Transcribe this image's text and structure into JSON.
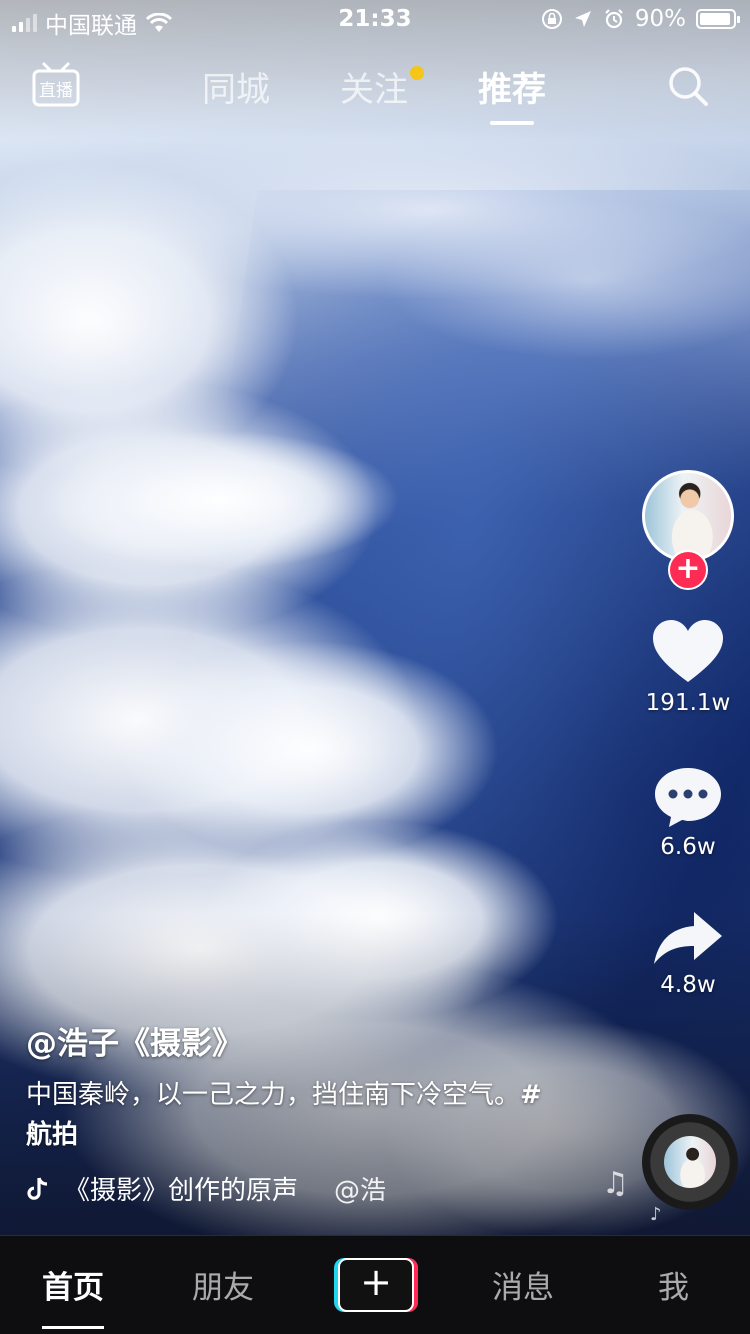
{
  "status_bar": {
    "carrier": "中国联通",
    "time": "21:33",
    "battery_percent": "90%"
  },
  "top_nav": {
    "live_label": "直播",
    "tabs": [
      {
        "label": "同城",
        "active": false
      },
      {
        "label": "关注",
        "active": false,
        "has_dot": true
      },
      {
        "label": "推荐",
        "active": true
      }
    ],
    "dot_color": "#f5c518"
  },
  "actions": {
    "likes": "191.1w",
    "comments": "6.6w",
    "shares": "4.8w",
    "follow_plus": "+",
    "accent_color": "#fe2c55"
  },
  "video_info": {
    "author": "@浩子《摄影》",
    "description": "中国秦岭，以一己之力，挡住南下冷空气。",
    "hashtag": "#航拍",
    "music": "《摄影》创作的原声",
    "music_scroll_extra": "@浩"
  },
  "tab_bar": {
    "items": [
      "首页",
      "朋友",
      "消息",
      "我"
    ],
    "active_index": 0,
    "plus_label": "+"
  }
}
